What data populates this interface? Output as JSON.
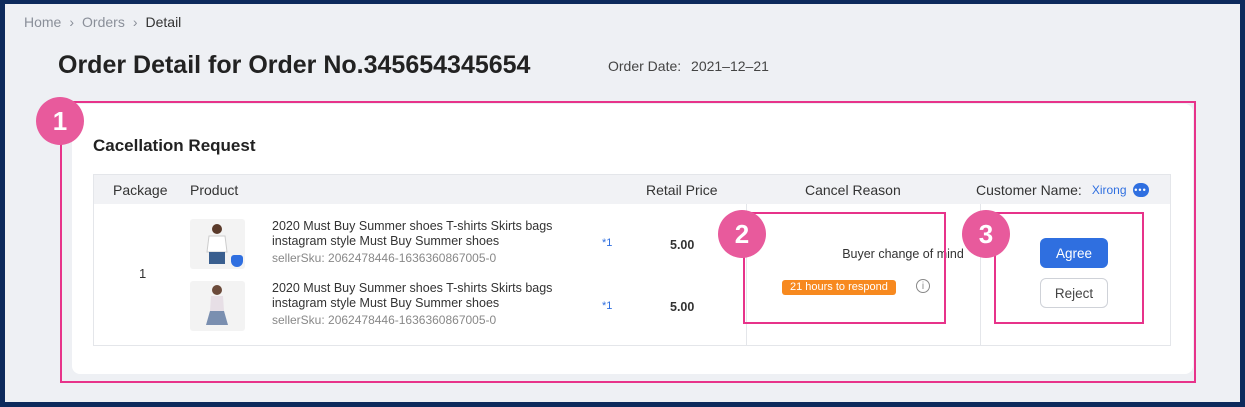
{
  "breadcrumb": {
    "items": [
      "Home",
      "Orders",
      "Detail"
    ]
  },
  "header": {
    "title": "Order Detail for Order No.345654345654",
    "order_date_label": "Order Date:",
    "order_date_value": "2021–12–21"
  },
  "section": {
    "title": "Cacellation Request"
  },
  "table": {
    "headers": {
      "package": "Package",
      "product": "Product",
      "retail_price": "Retail Price",
      "cancel_reason": "Cancel Reason",
      "customer_name": "Customer Name:"
    },
    "customer": "Xirong",
    "row": {
      "package": "1",
      "products": [
        {
          "name": "2020 Must Buy Summer shoes T-shirts Skirts bags instagram style Must Buy Summer shoes",
          "sku": "sellerSku: 2062478446-1636360867005-0",
          "qty": "*1",
          "price": "5.00"
        },
        {
          "name": "2020 Must Buy Summer shoes T-shirts Skirts bags instagram style Must Buy Summer shoes",
          "sku": "sellerSku: 2062478446-1636360867005-0",
          "qty": "*1",
          "price": "5.00"
        }
      ],
      "cancel_reason": "Buyer change of mind",
      "respond_tag": "21 hours to respond",
      "actions": {
        "agree": "Agree",
        "reject": "Reject"
      }
    }
  },
  "annotations": {
    "badge1": "1",
    "badge2": "2",
    "badge3": "3"
  },
  "icons": {
    "breadcrumb_sep": "chevron-right-icon",
    "chat": "chat-icon",
    "info": "info-icon",
    "shield": "shield-check-icon"
  },
  "colors": {
    "accent": "#2f6fe0",
    "highlight": "#e7338a",
    "badge": "#e85a9c",
    "respond": "#f7891f"
  }
}
